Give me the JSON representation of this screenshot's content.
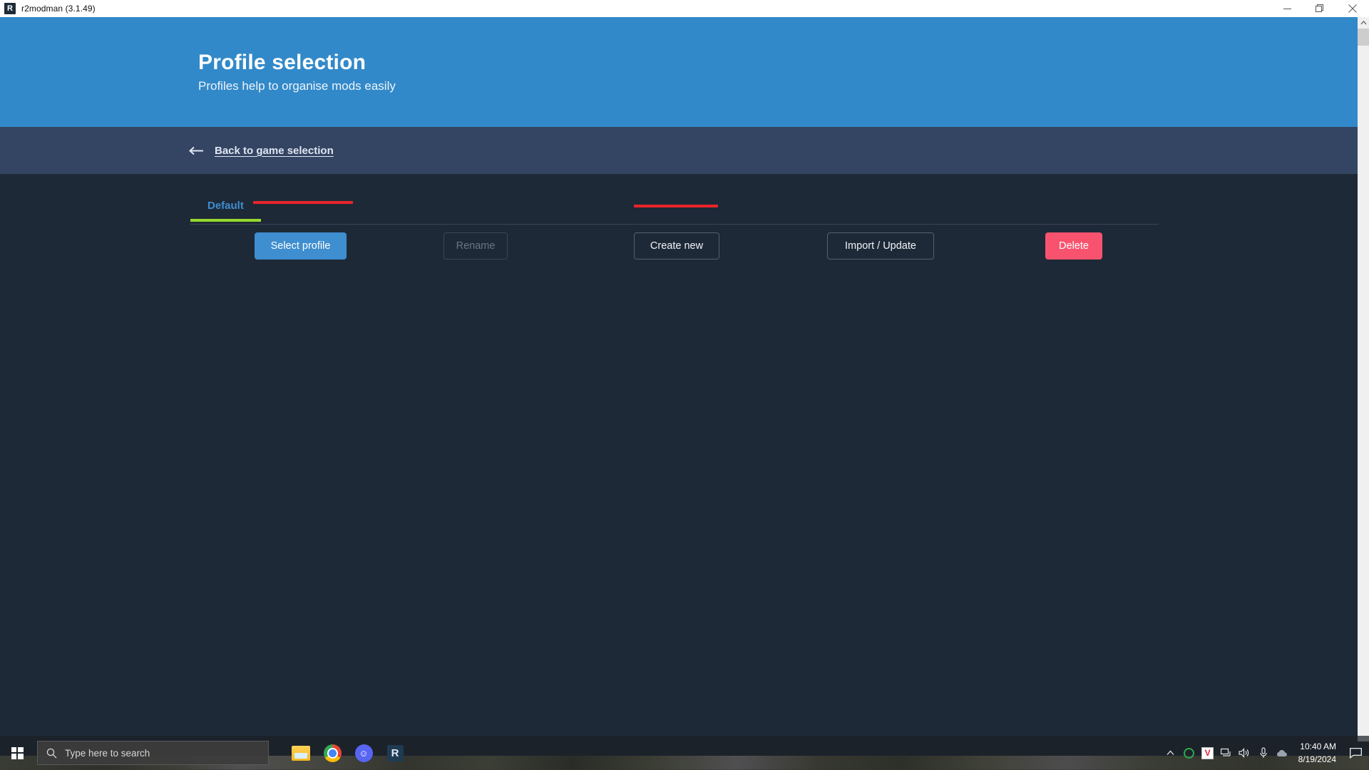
{
  "window": {
    "app_icon": "R",
    "title": "r2modman (3.1.49)",
    "controls": {
      "minimize": "minimize-icon",
      "restore": "restore-icon",
      "close": "close-icon"
    }
  },
  "header": {
    "title": "Profile selection",
    "subtitle": "Profiles help to organise mods easily",
    "bg_color": "#3289c9"
  },
  "back_bar": {
    "arrow_icon": "arrow-left-icon",
    "label": "Back to game selection",
    "bg_color": "#344563"
  },
  "tabs": [
    {
      "label": "Default",
      "active": true,
      "color": "#3e8ed0",
      "underline_color": "#96d92b"
    }
  ],
  "buttons": [
    {
      "name": "select-profile",
      "label": "Select profile",
      "style": "primary",
      "color": "#3e8ed0",
      "disabled": false
    },
    {
      "name": "rename",
      "label": "Rename",
      "style": "disabled",
      "color": "#6b7480",
      "disabled": true
    },
    {
      "name": "create-new",
      "label": "Create new",
      "style": "outline",
      "color": "#f0f3f7",
      "disabled": false
    },
    {
      "name": "import-update",
      "label": "Import / Update",
      "style": "outline",
      "color": "#f0f3f7",
      "disabled": false
    },
    {
      "name": "delete",
      "label": "Delete",
      "style": "danger",
      "color": "#f8536e",
      "disabled": false
    }
  ],
  "annotations": {
    "color": "#e8252a",
    "marks": [
      {
        "target": "select-profile-button"
      },
      {
        "target": "create-new-button"
      }
    ]
  },
  "scrollbar": {
    "up_arrow": "chevron-up-icon",
    "down_arrow": "chevron-down-icon"
  },
  "taskbar": {
    "start_icon": "windows-logo-icon",
    "search": {
      "icon": "search-icon",
      "placeholder": "Type here to search",
      "value": ""
    },
    "pinned": [
      {
        "name": "file-explorer",
        "icon": "folder-icon",
        "label": "File Explorer"
      },
      {
        "name": "google-chrome",
        "icon": "chrome-icon",
        "label": "Google Chrome"
      },
      {
        "name": "discord",
        "icon": "discord-icon",
        "label": "Discord"
      },
      {
        "name": "r2modman",
        "icon": "r2modman-icon",
        "label": "R"
      }
    ],
    "tray": [
      {
        "name": "show-hidden-icons",
        "icon": "chevron-up-icon",
        "glyph": "∧"
      },
      {
        "name": "antivirus",
        "icon": "shield-circle-icon",
        "glyph": ""
      },
      {
        "name": "vpn",
        "icon": "v-app-icon",
        "glyph": "V"
      },
      {
        "name": "network",
        "icon": "network-icon",
        "glyph": "὚7"
      },
      {
        "name": "volume",
        "icon": "speaker-icon",
        "glyph": "ὐA"
      },
      {
        "name": "microphone",
        "icon": "microphone-icon",
        "glyph": "Ἲ4"
      },
      {
        "name": "onedrive",
        "icon": "cloud-icon",
        "glyph": "☁"
      }
    ],
    "clock": {
      "time": "10:40 AM",
      "date": "8/19/2024"
    },
    "action_center_icon": "notification-icon"
  }
}
